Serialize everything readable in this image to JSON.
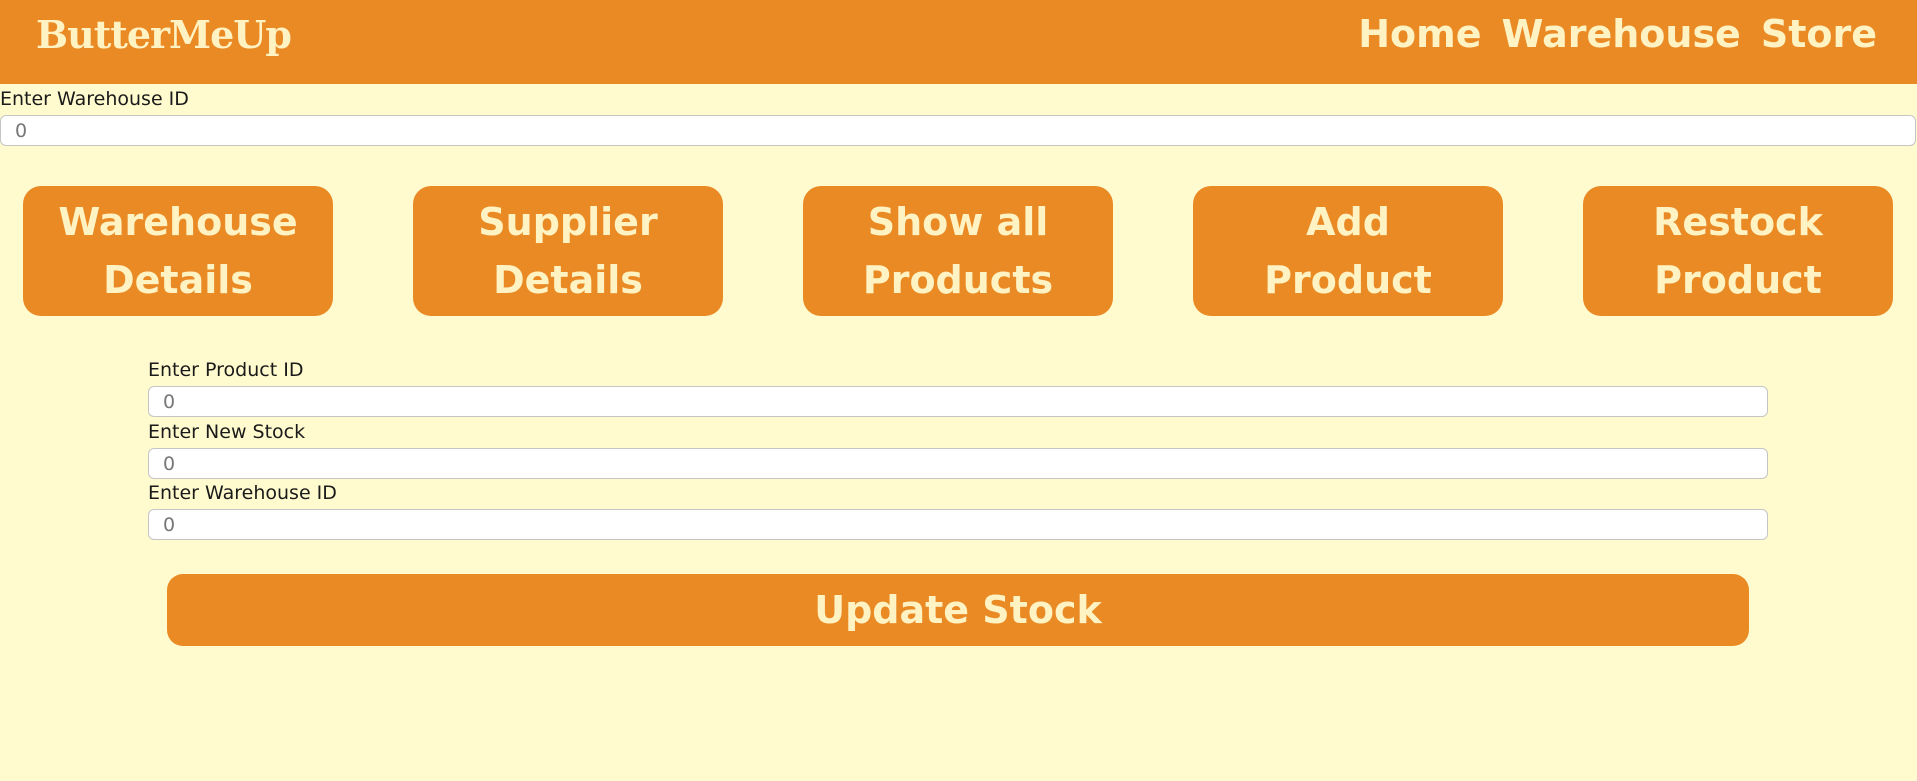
{
  "navbar": {
    "logo": "ButterMeUp",
    "links": [
      "Home",
      "Warehouse",
      "Store"
    ]
  },
  "warehouse_filter": {
    "label": "Enter Warehouse ID",
    "value": "0"
  },
  "actions": [
    {
      "label": "Warehouse Details"
    },
    {
      "label": "Supplier Details"
    },
    {
      "label": "Show all Products"
    },
    {
      "label": "Add Product"
    },
    {
      "label": "Restock Product"
    }
  ],
  "restock_form": {
    "product_id": {
      "label": "Enter Product ID",
      "value": "0"
    },
    "new_stock": {
      "label": "Enter New Stock",
      "value": "0"
    },
    "warehouse_id": {
      "label": "Enter Warehouse ID",
      "value": "0"
    },
    "submit_label": "Update Stock"
  },
  "colors": {
    "brand": "#ea8a25",
    "background": "#fffbcf",
    "brand_text": "#fff3c4"
  }
}
